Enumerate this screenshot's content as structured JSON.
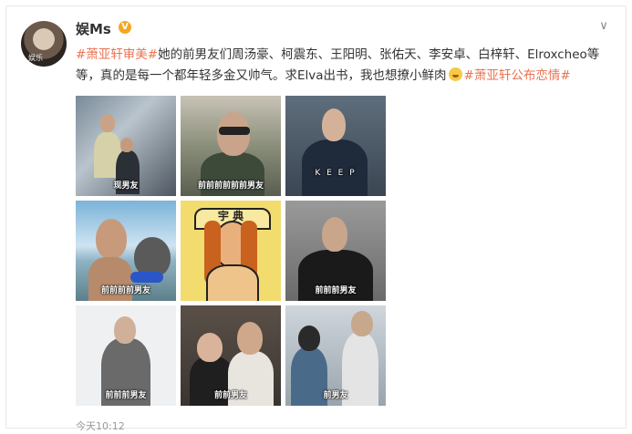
{
  "post": {
    "author": "娱Ms",
    "verified_badge": "V",
    "topic1": "#萧亚轩审美#",
    "body_text1": "她的前男友们周汤豪、柯震东、王阳明、张佑天、李安卓、白梓轩、Elroxcheo等等，真的是每一个都年轻多金又帅气。求Elva出书，我也想撩小鲜肉",
    "topic2": "#萧亚轩公布恋情#",
    "time": "今天10:12",
    "avatar_tag": "娱乐"
  },
  "photos": [
    {
      "label": "现男友"
    },
    {
      "label": "前前前前前前男友"
    },
    {
      "label": "K E E P"
    },
    {
      "label": "前前前前男友"
    },
    {
      "label": "宇 典"
    },
    {
      "label": "前前前男友"
    },
    {
      "label": "前前前男友"
    },
    {
      "label": "前前男友"
    },
    {
      "label": "前男友"
    }
  ],
  "colors": {
    "topic": "#eb7350",
    "verified": "#f5a623"
  }
}
